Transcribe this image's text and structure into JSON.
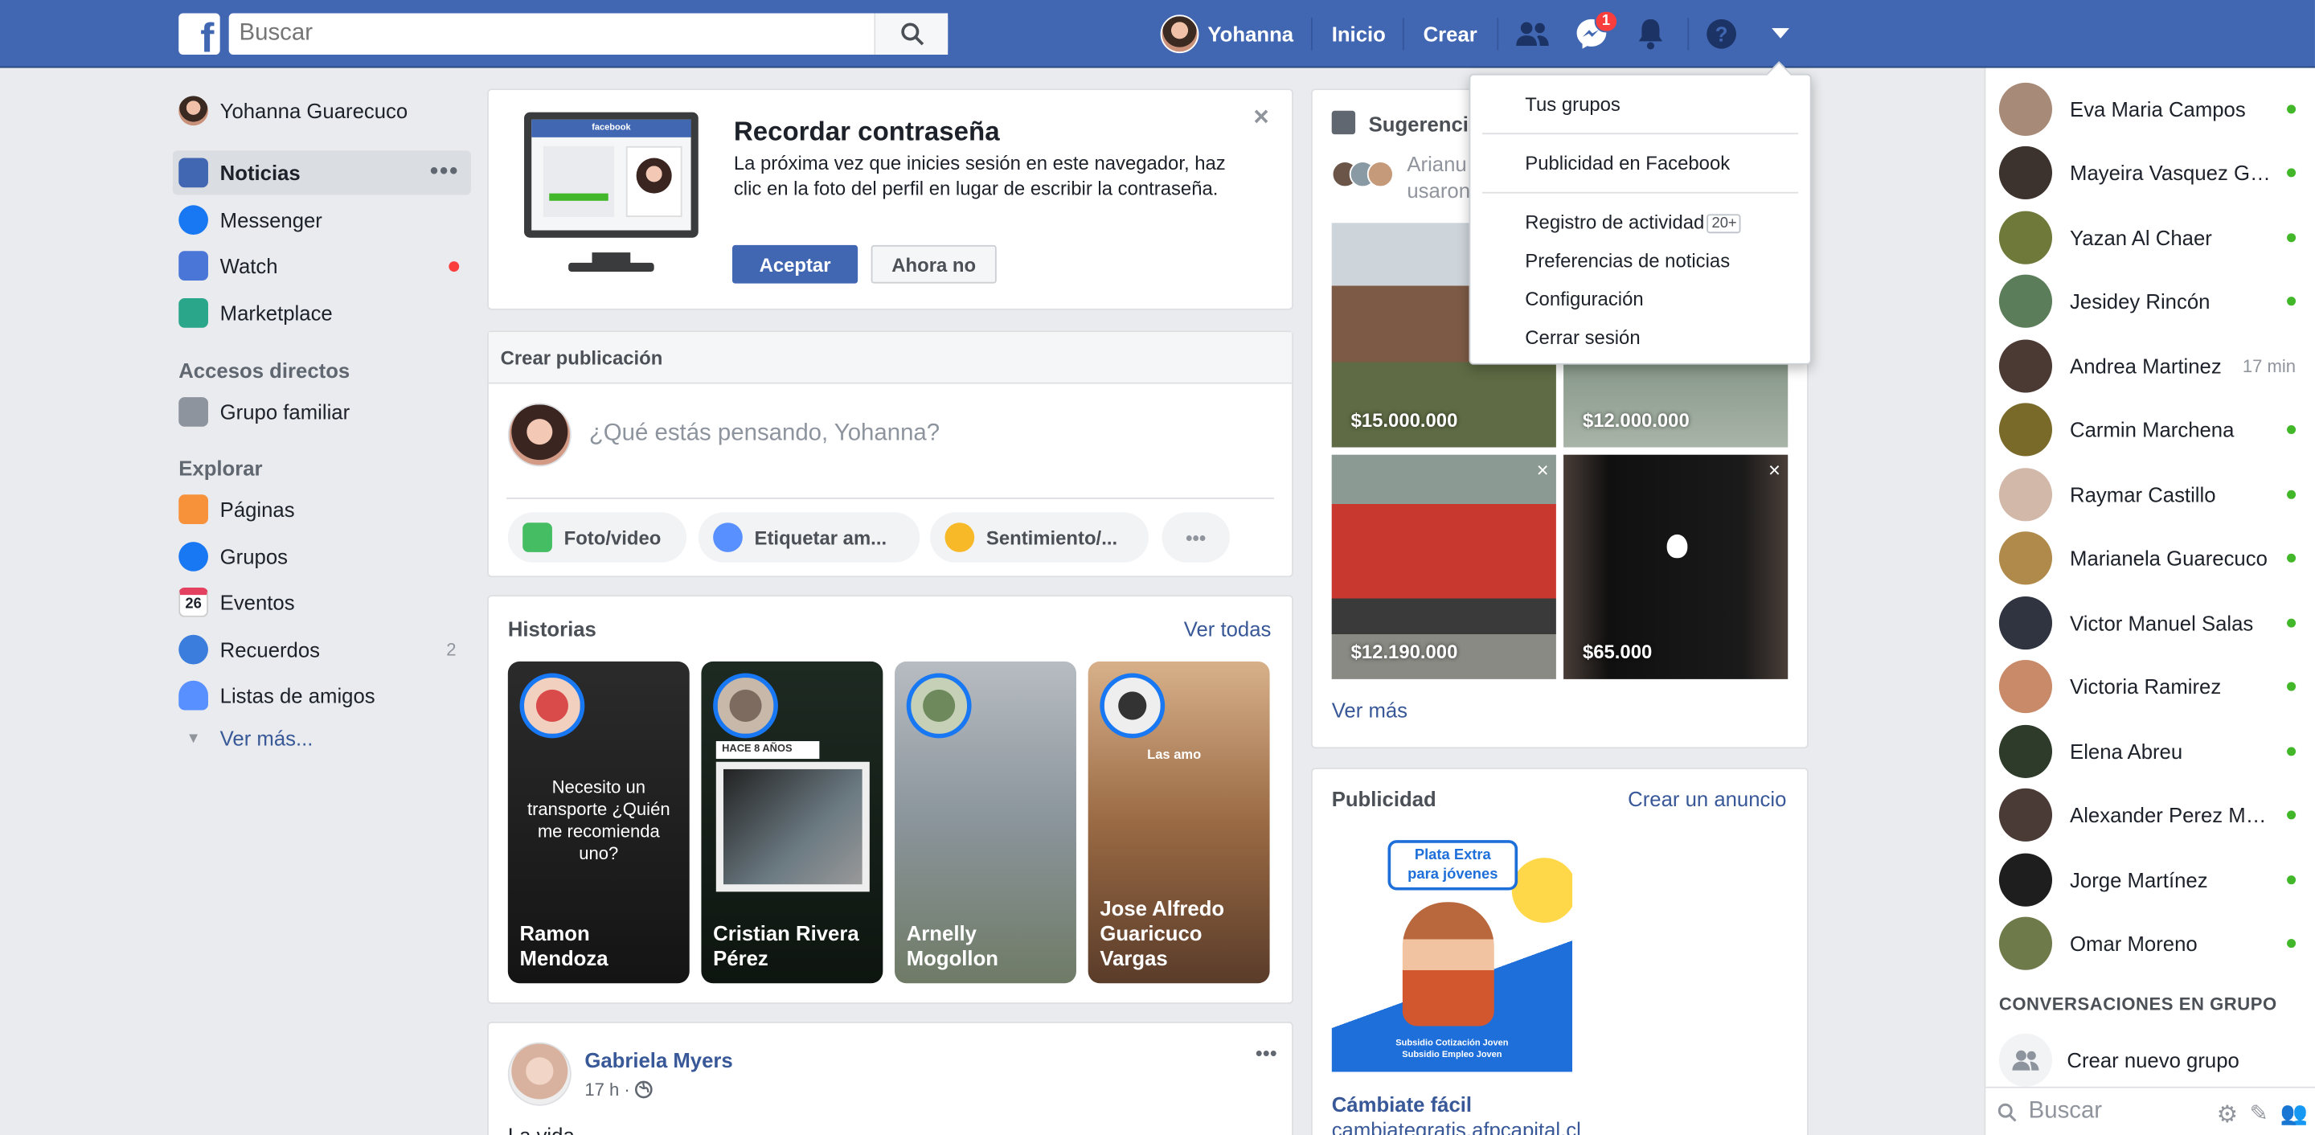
{
  "topbar": {
    "logo": "f",
    "search_placeholder": "Buscar",
    "profile_name": "Yohanna",
    "nav": {
      "home": "Inicio",
      "create": "Crear"
    },
    "messages_badge": "1",
    "icons": [
      "friend-requests-icon",
      "messenger-icon",
      "notifications-icon",
      "help-icon",
      "account-menu-caret-icon"
    ],
    "accent_color": "#4267b2"
  },
  "left_nav": {
    "profile": "Yohanna Guarecuco",
    "main": [
      {
        "label": "Noticias",
        "icon": "news-feed-icon",
        "active": true
      },
      {
        "label": "Messenger",
        "icon": "messenger-icon"
      },
      {
        "label": "Watch",
        "icon": "watch-icon",
        "has_dot": true
      },
      {
        "label": "Marketplace",
        "icon": "marketplace-icon"
      }
    ],
    "shortcuts_heading": "Accesos directos",
    "shortcuts": [
      {
        "label": "Grupo familiar",
        "icon": "group-icon"
      }
    ],
    "explore_heading": "Explorar",
    "explore": [
      {
        "label": "Páginas",
        "icon": "pages-flag-icon"
      },
      {
        "label": "Grupos",
        "icon": "groups-icon"
      },
      {
        "label": "Eventos",
        "icon": "calendar-icon",
        "icon_text": "26"
      },
      {
        "label": "Recuerdos",
        "icon": "memories-clock-icon",
        "count": "2"
      },
      {
        "label": "Listas de amigos",
        "icon": "friend-lists-icon"
      }
    ],
    "more": "Ver más..."
  },
  "reminder": {
    "title": "Recordar contraseña",
    "text": "La próxima vez que inicies sesión en este navegador, haz clic en la foto del perfil en lugar de escribir la contraseña.",
    "accept": "Aceptar",
    "decline": "Ahora no",
    "monitor_brand": "facebook"
  },
  "composer": {
    "heading": "Crear publicación",
    "placeholder": "¿Qué estás pensando, Yohanna?",
    "actions": [
      "Foto/video",
      "Etiquetar am...",
      "Sentimiento/..."
    ]
  },
  "stories": {
    "title": "Historias",
    "see_all": "Ver todas",
    "items": [
      {
        "name": "Ramon Mendoza",
        "text": "Necesito un transporte ¿Quién me recomienda uno?"
      },
      {
        "name": "Cristian Rivera Pérez",
        "overlay": "HACE 8 AÑOS"
      },
      {
        "name": "Arnelly Mogollon"
      },
      {
        "name": "Jose Alfredo Guaricuco Vargas",
        "overlay": "Las amo"
      }
    ]
  },
  "post": {
    "author": "Gabriela Myers",
    "time": "17 h ·",
    "text": "La vida"
  },
  "marketplace": {
    "title": "Sugerencias",
    "sub_line1": "Arianu",
    "sub_line2": "usaron",
    "items": [
      {
        "price": "$15.000.000",
        "image": "wooden-house"
      },
      {
        "price": "$12.000.000",
        "image": "river-rocks"
      },
      {
        "price": "$12.190.000",
        "image": "red-pickup-truck"
      },
      {
        "price": "$65.000",
        "image": "phone-apple-logo"
      }
    ],
    "more": "Ver más"
  },
  "ads": {
    "title": "Publicidad",
    "create": "Crear un anuncio",
    "image_title_1": "Plata Extra",
    "image_title_2": "para jóvenes",
    "image_footer_1": "Subsidio Cotización Joven",
    "image_footer_2": "Subsidio Empleo Joven",
    "headline": "Cámbiate fácil",
    "url": "cambiategratis.afpcapital.cl"
  },
  "dropdown": {
    "items": [
      {
        "label": "Tus grupos"
      },
      {
        "label": "Publicidad en Facebook"
      },
      {
        "label": "Registro de actividad",
        "badge": "20+"
      },
      {
        "label": "Preferencias de noticias"
      },
      {
        "label": "Configuración"
      },
      {
        "label": "Cerrar sesión"
      }
    ]
  },
  "chat": {
    "contacts": [
      {
        "name": "Eva Maria Campos",
        "online": true
      },
      {
        "name": "Mayeira Vasquez Garcia",
        "online": true
      },
      {
        "name": "Yazan Al Chaer",
        "online": true
      },
      {
        "name": "Jesidey Rincón",
        "online": true
      },
      {
        "name": "Andrea Martinez",
        "last_active": "17 min"
      },
      {
        "name": "Carmin Marchena",
        "online": true
      },
      {
        "name": "Raymar Castillo",
        "online": true
      },
      {
        "name": "Marianela Guarecuco",
        "online": true
      },
      {
        "name": "Victor Manuel Salas",
        "online": true
      },
      {
        "name": "Victoria Ramirez",
        "online": true
      },
      {
        "name": "Elena Abreu",
        "online": true
      },
      {
        "name": "Alexander Perez Medina",
        "online": true
      },
      {
        "name": "Jorge Martínez",
        "online": true
      },
      {
        "name": "Omar Moreno",
        "online": true
      }
    ],
    "group_heading": "CONVERSACIONES EN GRUPO",
    "new_group": "Crear nuevo grupo",
    "search_placeholder": "Buscar"
  }
}
